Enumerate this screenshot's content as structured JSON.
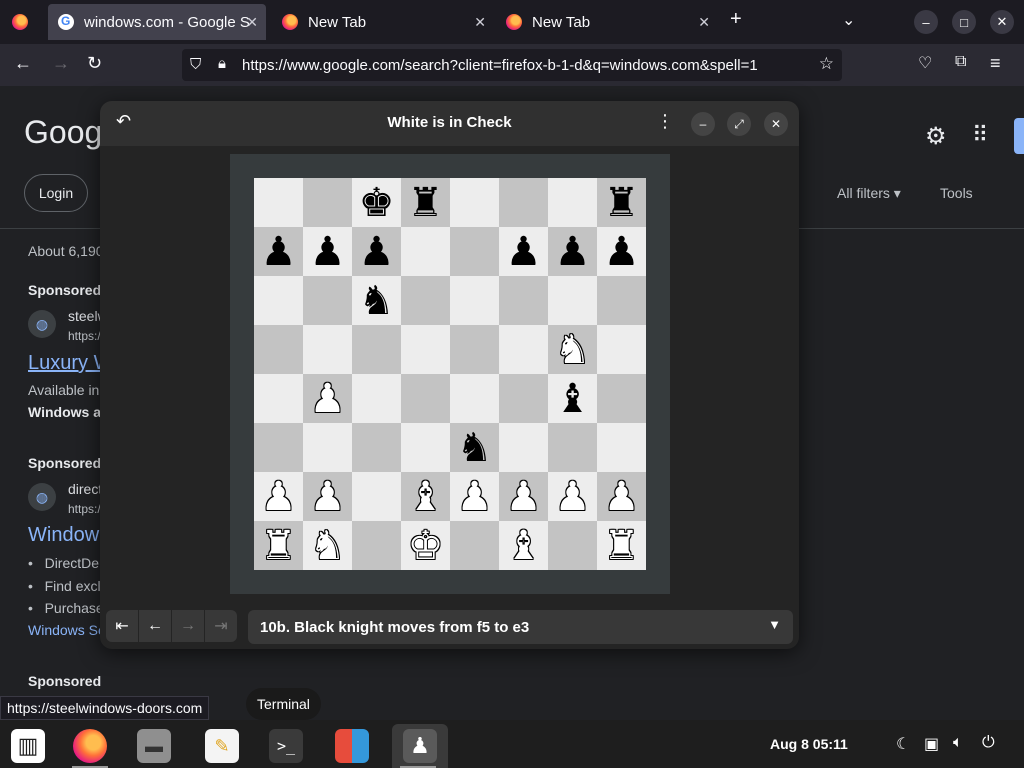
{
  "browser": {
    "tabs": [
      {
        "title": "windows.com - Google S",
        "favicon": "google-g-icon",
        "active": true
      },
      {
        "title": "New Tab",
        "favicon": "firefox-icon",
        "active": false
      },
      {
        "title": "New Tab",
        "favicon": "firefox-icon",
        "active": false
      }
    ],
    "url": "https://www.google.com/search?client=firefox-b-1-d&q=windows.com&spell=1"
  },
  "google": {
    "logo": "Googl",
    "login": "Login",
    "result_count": "About 6,190",
    "filters": "All filters",
    "tools": "Tools",
    "sponsored": "Sponsored",
    "ad1_site": "steelw",
    "ad1_url": "https:/",
    "ad1_title": "Luxury W",
    "ad1_line1": "Available in",
    "ad1_line2": "Windows a",
    "ad2_site": "direct",
    "ad2_url": "https:/",
    "ad2_title": "Window",
    "ad2_bullets": [
      "DirectDe",
      "Find excl",
      "Purchase"
    ],
    "ad2_link": "Windows Se"
  },
  "chess": {
    "title": "White is in Check",
    "board": [
      [
        "",
        "",
        "bk",
        "br",
        "",
        "",
        "",
        "br"
      ],
      [
        "bp",
        "bp",
        "bp",
        "",
        "",
        "bp",
        "bp",
        "bp"
      ],
      [
        "",
        "",
        "bn",
        "",
        "",
        "",
        "",
        ""
      ],
      [
        "",
        "",
        "",
        "",
        "",
        "",
        "wn",
        ""
      ],
      [
        "",
        "wp",
        "",
        "",
        "",
        "",
        "bb",
        ""
      ],
      [
        "",
        "",
        "",
        "",
        "bn",
        "",
        "",
        ""
      ],
      [
        "wp",
        "wp",
        "",
        "wb",
        "wp",
        "wp",
        "wp",
        "wp"
      ],
      [
        "wr",
        "wn",
        "",
        "wk",
        "",
        "wb",
        "",
        "wr"
      ]
    ],
    "move_text": "10b. Black knight moves from f5 to e3"
  },
  "status_link": "https://steelwindows-doors.com",
  "tooltip": "Terminal",
  "clock": "Aug 8  05:11"
}
